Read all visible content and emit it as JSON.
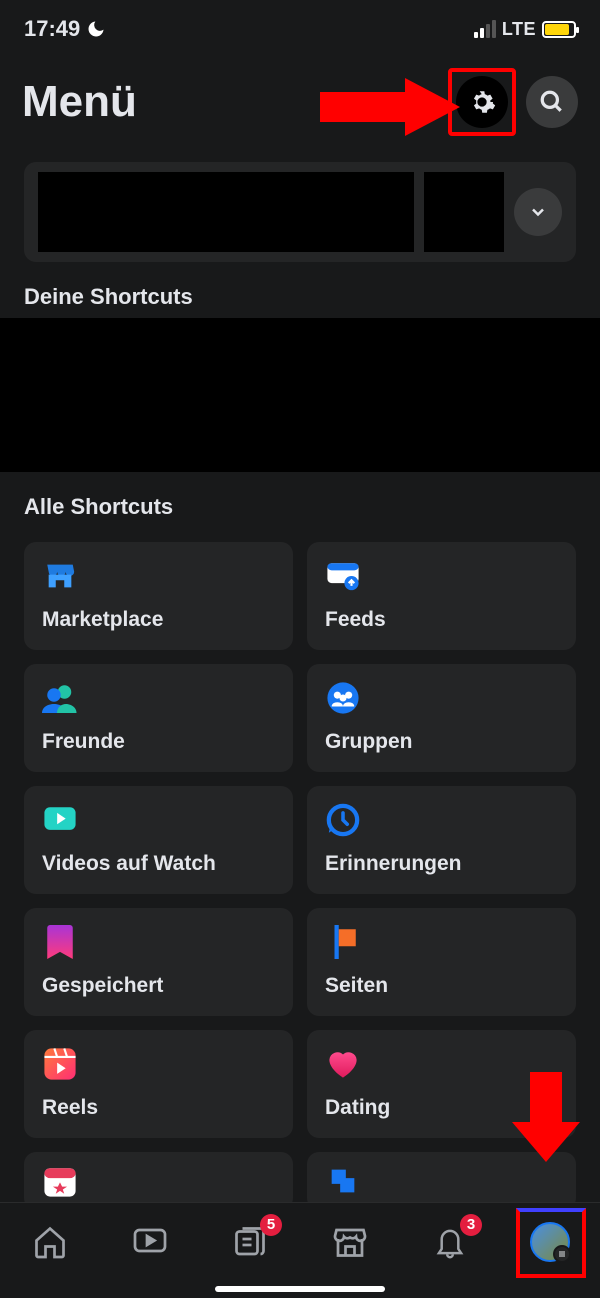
{
  "status": {
    "time": "17:49",
    "network": "LTE"
  },
  "header": {
    "title": "Menü"
  },
  "sections": {
    "your_shortcuts": "Deine Shortcuts",
    "all_shortcuts": "Alle Shortcuts"
  },
  "shortcuts": [
    {
      "label": "Marketplace",
      "icon": "marketplace"
    },
    {
      "label": "Feeds",
      "icon": "feeds"
    },
    {
      "label": "Freunde",
      "icon": "friends"
    },
    {
      "label": "Gruppen",
      "icon": "groups"
    },
    {
      "label": "Videos auf Watch",
      "icon": "watch"
    },
    {
      "label": "Erinnerungen",
      "icon": "memories"
    },
    {
      "label": "Gespeichert",
      "icon": "saved"
    },
    {
      "label": "Seiten",
      "icon": "pages"
    },
    {
      "label": "Reels",
      "icon": "reels"
    },
    {
      "label": "Dating",
      "icon": "dating"
    }
  ],
  "partial_shortcuts": [
    {
      "icon": "events"
    },
    {
      "icon": "gaming"
    }
  ],
  "tabbar": {
    "badges": {
      "news": "5",
      "notifications": "3"
    }
  },
  "annotations": {
    "arrow1_target": "settings-button",
    "arrow2_target": "menu-tab"
  }
}
